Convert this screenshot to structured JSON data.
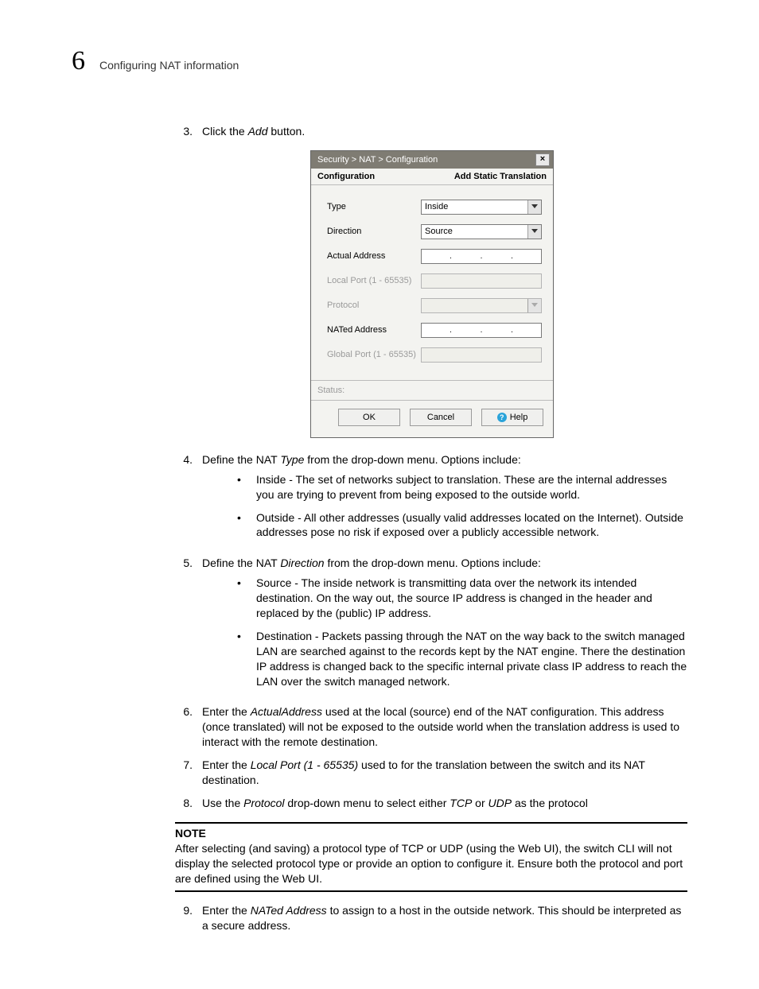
{
  "page": {
    "chapter_number": "6",
    "chapter_title": "Configuring NAT information"
  },
  "steps": {
    "s3": {
      "num": "3.",
      "text_before": "Click the ",
      "italic": "Add",
      "text_after": " button."
    },
    "s4": {
      "num": "4.",
      "text_before": "Define the NAT ",
      "italic": "Type",
      "text_after": " from the drop-down menu. Options include:"
    },
    "s4_bullets": [
      "Inside - The set of networks subject to translation. These are the internal addresses you are trying to prevent from being exposed to the outside world.",
      "Outside - All other addresses (usually valid addresses located on the Internet). Outside addresses pose no risk if exposed over a publicly accessible network."
    ],
    "s5": {
      "num": "5.",
      "text_before": "Define the NAT ",
      "italic": "Direction",
      "text_after": " from the drop-down menu. Options include:"
    },
    "s5_bullets": [
      "Source - The inside network is transmitting data over the network its intended destination. On the way out, the source IP address is changed in the header and replaced by the (public) IP address.",
      "Destination - Packets passing through the NAT on the way back to the switch managed LAN are searched against to the records kept by the NAT engine. There the destination IP address is changed back to the specific internal private class IP address to reach the LAN over the switch managed network."
    ],
    "s6": {
      "num": "6.",
      "text_before": "Enter the ",
      "italic": "ActualAddress",
      "text_after": " used at the local (source) end of the NAT configuration. This address (once translated) will not be exposed to the outside world when the translation address is used to interact with the remote destination."
    },
    "s7": {
      "num": "7.",
      "text_before": "Enter the ",
      "italic": "Local Port (1 - 65535)",
      "text_after": " used to for the translation between the switch and its NAT destination."
    },
    "s8": {
      "num": "8.",
      "text_before": "Use the ",
      "italic": "Protocol",
      "text_mid": " drop-down menu to select either ",
      "italic2": "TCP",
      "text_mid2": " or ",
      "italic3": "UDP",
      "text_after": " as the protocol"
    },
    "s9": {
      "num": "9.",
      "text_before": "Enter the ",
      "italic": "NATed Address",
      "text_after": " to assign to a host in the outside network. This should be interpreted as a secure address."
    }
  },
  "note": {
    "title": "NOTE",
    "body": "After selecting (and saving) a protocol type of TCP or UDP (using the Web UI), the switch CLI will not display the selected protocol type or provide an option to configure it. Ensure both the protocol and port are defined using the Web UI."
  },
  "dialog": {
    "breadcrumb": "Security > NAT > Configuration",
    "close_glyph": "×",
    "header_left": "Configuration",
    "header_right": "Add Static Translation",
    "fields": {
      "type": {
        "label": "Type",
        "value": "Inside"
      },
      "direction": {
        "label": "Direction",
        "value": "Source"
      },
      "actual": {
        "label": "Actual Address"
      },
      "local_port": {
        "label": "Local Port (1 - 65535)"
      },
      "protocol": {
        "label": "Protocol",
        "value": ""
      },
      "nated": {
        "label": "NATed Address"
      },
      "global_port": {
        "label": "Global Port (1 - 65535)"
      }
    },
    "status_label": "Status:",
    "buttons": {
      "ok": "OK",
      "cancel": "Cancel",
      "help": "Help"
    },
    "help_icon_glyph": "?"
  }
}
